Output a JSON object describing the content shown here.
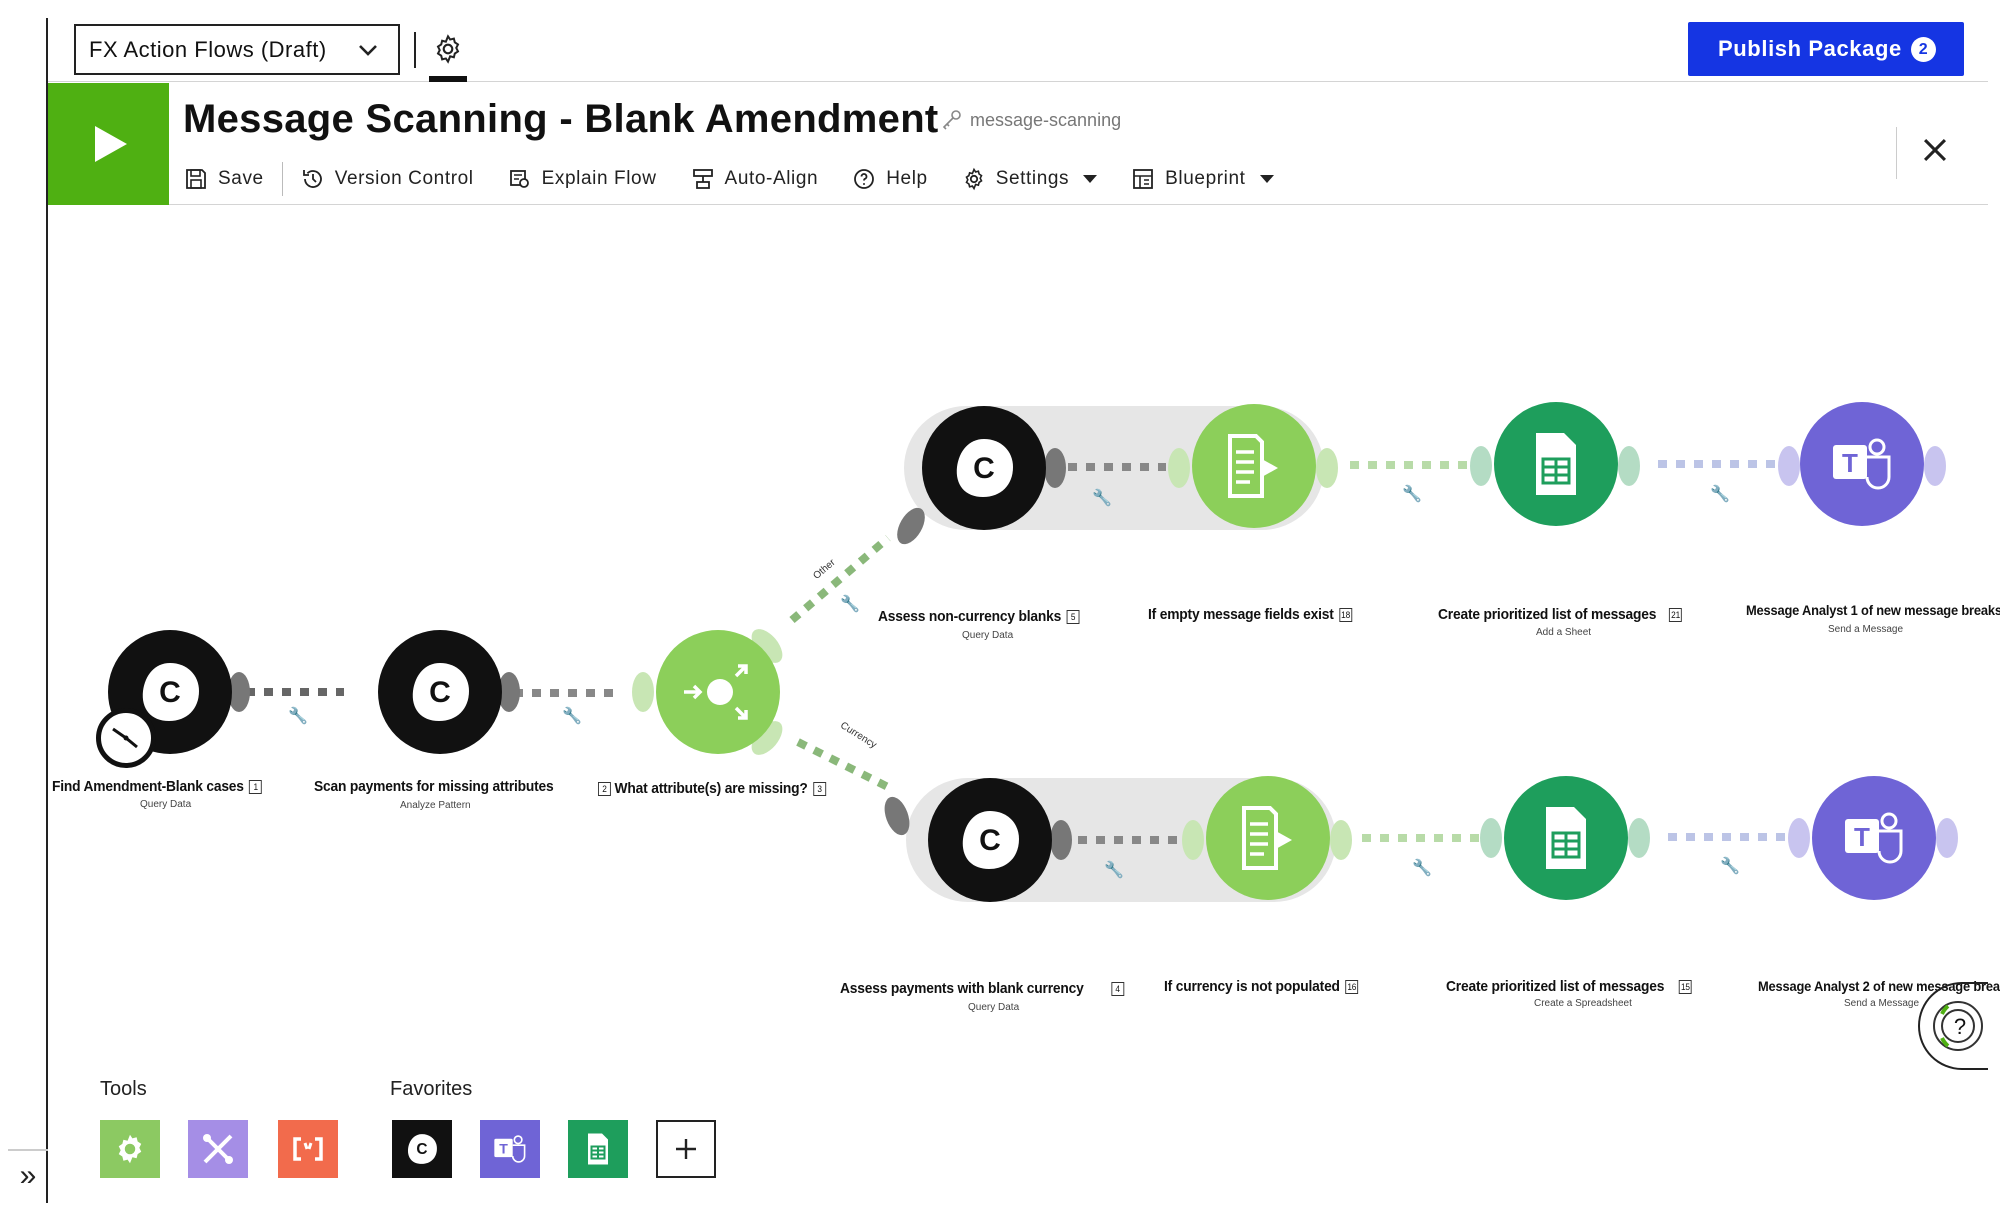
{
  "topbar": {
    "package_name": "FX Action Flows (Draft)",
    "publish_label": "Publish Package",
    "publish_count": "2"
  },
  "flow": {
    "title": "Message Scanning - Blank Amendment",
    "key": "message-scanning"
  },
  "toolbar": {
    "save": "Save",
    "version_control": "Version Control",
    "explain_flow": "Explain Flow",
    "auto_align": "Auto-Align",
    "help": "Help",
    "settings": "Settings",
    "blueprint": "Blueprint"
  },
  "nodes": {
    "n1": {
      "label": "Find Amendment-Blank cases",
      "index": "1",
      "sub": "Query Data"
    },
    "n2": {
      "label": "Scan payments for missing attributes",
      "index": "2",
      "sub": "Analyze Pattern"
    },
    "n3": {
      "label": "What attribute(s) are missing?",
      "index": "3",
      "sub": ""
    },
    "n5": {
      "label": "Assess non-currency blanks",
      "index": "5",
      "sub": "Query Data"
    },
    "n18": {
      "label": "If empty message fields exist",
      "index": "18",
      "sub": ""
    },
    "n21": {
      "label": "Create prioritized list of messages",
      "index": "21",
      "sub": "Add a Sheet"
    },
    "t1": {
      "label": "Message Analyst 1 of new message breaks",
      "sub": "Send a Message"
    },
    "n4": {
      "label": "Assess payments with blank currency",
      "index": "4",
      "sub": "Query Data"
    },
    "n16": {
      "label": "If currency is not populated",
      "index": "16",
      "sub": ""
    },
    "n15": {
      "label": "Create prioritized list of messages",
      "index": "15",
      "sub": "Create a Spreadsheet"
    },
    "t2": {
      "label": "Message Analyst 2 of new message brea",
      "sub": "Send a Message"
    }
  },
  "routes": {
    "other": "Other",
    "currency": "Currency"
  },
  "panels": {
    "tools_title": "Tools",
    "favorites_title": "Favorites"
  },
  "colors": {
    "run_green": "#4fb012",
    "publish_blue": "#1535e3",
    "router_green": "#8ccf5a",
    "sheets_green": "#1e9e5c",
    "teams_purple": "#6f64d6"
  }
}
